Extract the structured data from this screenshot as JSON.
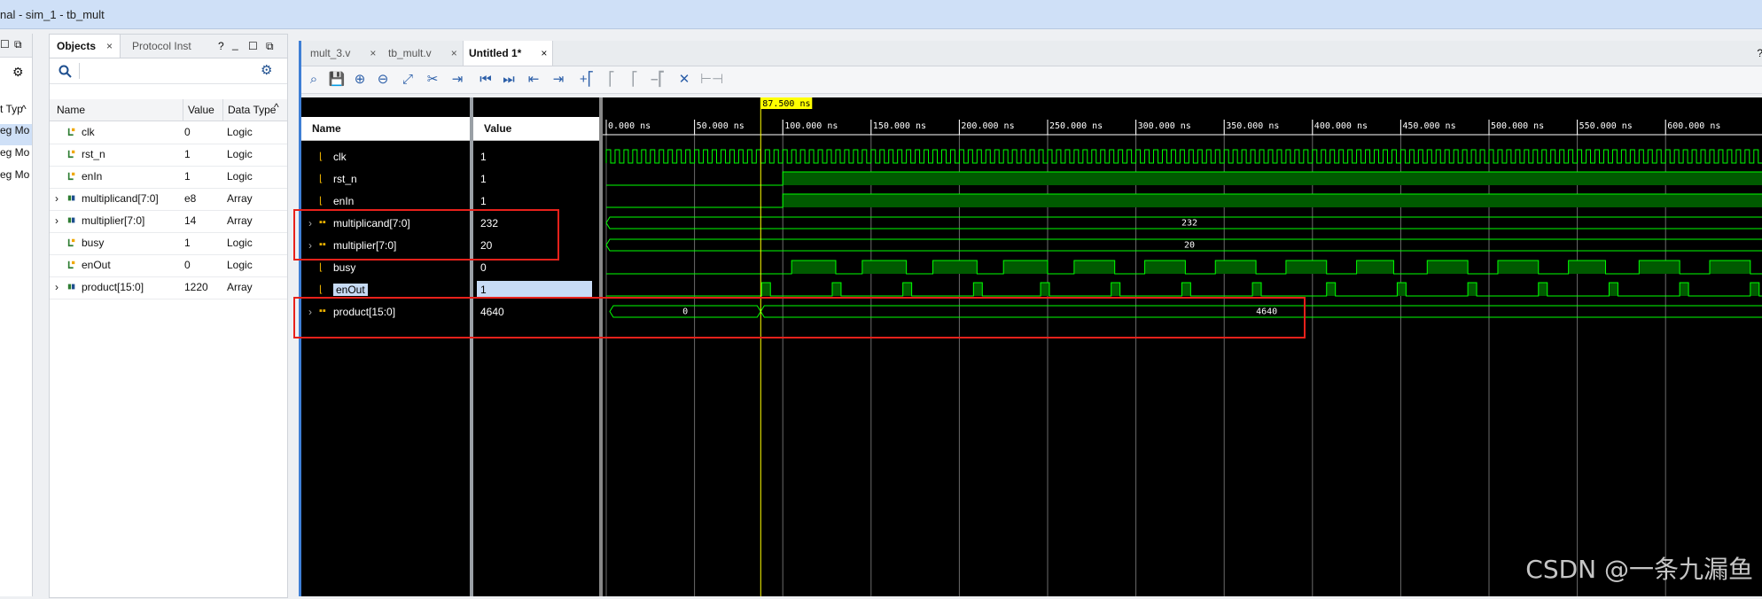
{
  "window": {
    "title": "nal - sim_1 - tb_mult"
  },
  "left_strip": {
    "rows": [
      "t Typ",
      "eg Mo",
      "eg Mo",
      "eg Mo"
    ]
  },
  "objects_panel": {
    "tabs": [
      {
        "label": "Objects",
        "active": true
      },
      {
        "label": "Protocol Inst",
        "active": false
      }
    ],
    "close_glyph": "×",
    "win_buttons": [
      "?",
      "_",
      "☐",
      "⧉"
    ],
    "columns": [
      "Name",
      "Value",
      "Data Type"
    ],
    "rows": [
      {
        "name": "clk",
        "value": "0",
        "type": "Logic",
        "expandable": false
      },
      {
        "name": "rst_n",
        "value": "1",
        "type": "Logic",
        "expandable": false
      },
      {
        "name": "enIn",
        "value": "1",
        "type": "Logic",
        "expandable": false
      },
      {
        "name": "multiplicand[7:0]",
        "value": "e8",
        "type": "Array",
        "expandable": true
      },
      {
        "name": "multiplier[7:0]",
        "value": "14",
        "type": "Array",
        "expandable": true
      },
      {
        "name": "busy",
        "value": "1",
        "type": "Logic",
        "expandable": false
      },
      {
        "name": "enOut",
        "value": "0",
        "type": "Logic",
        "expandable": false
      },
      {
        "name": "product[15:0]",
        "value": "1220",
        "type": "Array",
        "expandable": true
      }
    ]
  },
  "wave_window": {
    "tabs": [
      {
        "label": "mult_3.v",
        "active": false
      },
      {
        "label": "tb_mult.v",
        "active": false
      },
      {
        "label": "Untitled 1*",
        "active": true
      }
    ],
    "help_glyph": "?",
    "toolbar_icons": [
      "search-icon",
      "save-icon",
      "zoom-in-icon",
      "zoom-out-icon",
      "zoom-fit-icon",
      "swap-cursor-icon",
      "goto-cursor-icon",
      "go-to-start-icon",
      "go-to-end-icon",
      "prev-transition-icon",
      "next-transition-icon",
      "add-marker-icon",
      "prev-marker-icon",
      "next-marker-icon",
      "delete-marker-icon",
      "delete-all-markers-icon",
      "disabled-icon"
    ],
    "name_header": "Name",
    "value_header": "Value",
    "cursor_label": "87.500 ns",
    "time_ticks": [
      "0.000 ns",
      "50.000 ns",
      "100.000 ns",
      "150.000 ns",
      "200.000 ns",
      "250.000 ns",
      "300.000 ns",
      "350.000 ns",
      "400.000 ns",
      "450.000 ns",
      "500.000 ns",
      "550.000 ns",
      "600.000 ns"
    ],
    "signals": [
      {
        "name": "clk",
        "value": "1",
        "bus": false,
        "selected": false
      },
      {
        "name": "rst_n",
        "value": "1",
        "bus": false,
        "selected": false
      },
      {
        "name": "enIn",
        "value": "1",
        "bus": false,
        "selected": false
      },
      {
        "name": "multiplicand[7:0]",
        "value": "232",
        "bus": true,
        "selected": false
      },
      {
        "name": "multiplier[7:0]",
        "value": "20",
        "bus": true,
        "selected": false
      },
      {
        "name": "busy",
        "value": "0",
        "bus": false,
        "selected": false
      },
      {
        "name": "enOut",
        "value": "1",
        "bus": false,
        "selected": true
      },
      {
        "name": "product[15:0]",
        "value": "4640",
        "bus": true,
        "selected": false
      }
    ],
    "bus_labels": {
      "multiplicand": "232",
      "multiplier": "20",
      "product_before": "0",
      "product_after": "4640"
    }
  },
  "watermark": "CSDN @一条九漏鱼",
  "colors": {
    "wave": "#00ff00",
    "wave_fill": "#005a00",
    "cursor": "#ffff00",
    "annotation": "#e8211b",
    "accent": "#3f7fd5"
  }
}
